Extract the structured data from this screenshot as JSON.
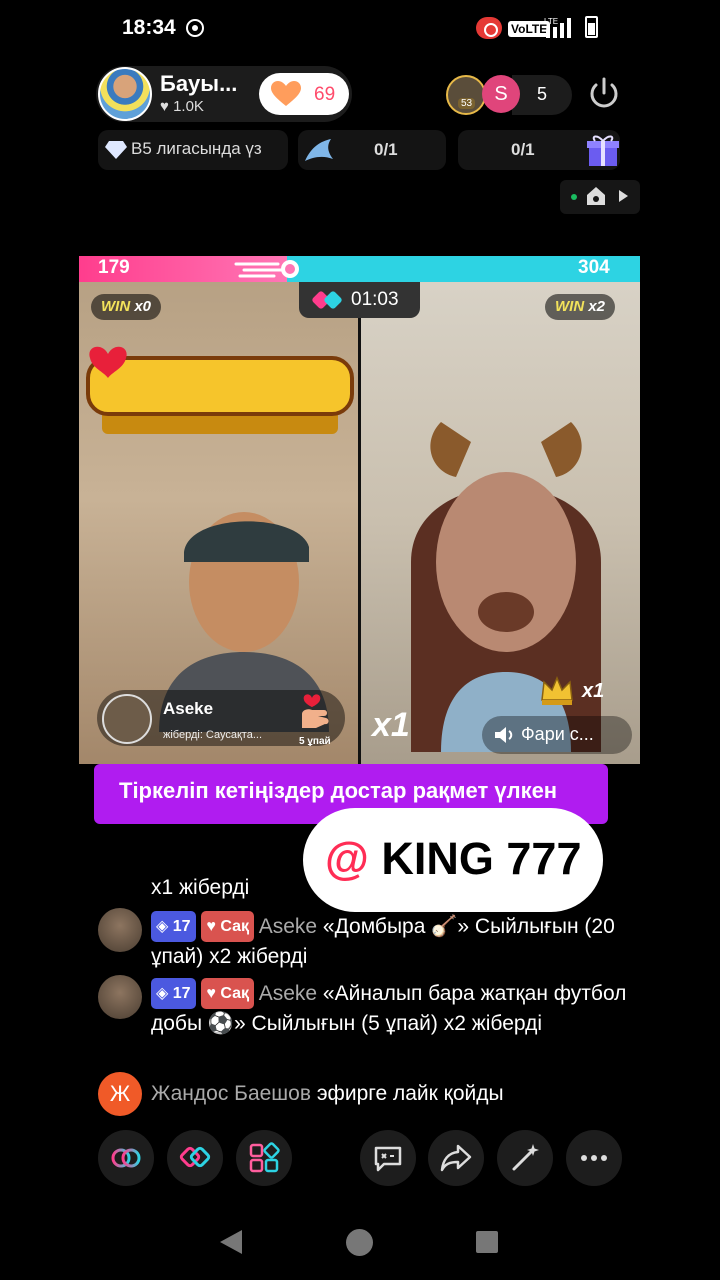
{
  "status_bar": {
    "time": "18:34",
    "volte": "VoLTE",
    "network": "LTE"
  },
  "host": {
    "name": "Бауы...",
    "likes": "1.0K",
    "follow_count": "69"
  },
  "viewers": {
    "avatar2_letter": "S",
    "avatar1_badge": "53",
    "count": "5"
  },
  "league": {
    "text": "B5 лигасында үз"
  },
  "tasks": {
    "task1": "0/1",
    "task2": "0/1"
  },
  "battle": {
    "score_left": "179",
    "score_right": "304",
    "timer": "01:03",
    "win_left_label": "WIN",
    "win_left_mult": "x0",
    "win_right_label": "WIN",
    "win_right_mult": "x2",
    "left_progress": 0.37,
    "gift_user": {
      "name": "Aseke",
      "sub": "жіберді: Саусақта...",
      "caption": "5 ұпай"
    },
    "crown_multiplier": "x1",
    "big_multiplier": "x1",
    "right_user": "Фари с..."
  },
  "banner": {
    "text": "Тіркеліп кетіңіздер достар рақмет үлкен"
  },
  "mention": {
    "at": "@",
    "text": "KING 777"
  },
  "chat": {
    "cut_line": "x1 жіберді",
    "messages": [
      {
        "level": "17",
        "fan_badge": "Сақ",
        "user": "Aseke",
        "text": "«Домбыра 🪕» Сыйлығын (20 ұпай) x2 жіберді"
      },
      {
        "level": "17",
        "fan_badge": "Сақ",
        "user": "Aseke",
        "text": "«Айналып бара жатқан футбол добы ⚽» Сыйлығын (5 ұпай) x2 жіберді"
      },
      {
        "avatar_letter": "Ж",
        "user": "Жандос Баешов",
        "text": "эфирге лайк қойды"
      }
    ]
  },
  "colors": {
    "accent_pink": "#ff3d8d",
    "accent_cyan": "#2dd3e3",
    "banner_purple": "#b01cf0"
  }
}
